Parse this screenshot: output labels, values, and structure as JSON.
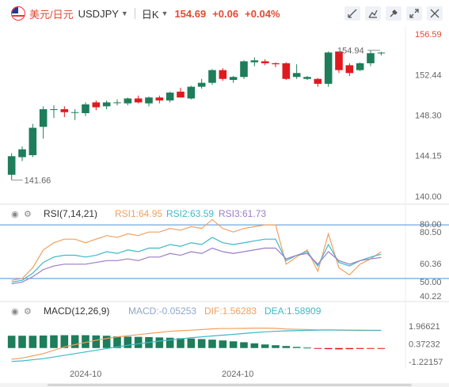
{
  "header": {
    "pair_cn": "美元/日元",
    "symbol": "USDJPY",
    "period": "日K",
    "price": "154.69",
    "change": "+0.06",
    "change_pct": "+0.04%"
  },
  "toolbar_icons": [
    "drawing-icon",
    "indicator-icon",
    "settings-icon",
    "fullscreen-icon",
    "maximize-icon"
  ],
  "colors": {
    "up": "#1e7d5a",
    "down": "#e0191f",
    "accent_red": "#e24a33",
    "rsi1": "#f0a060",
    "rsi2": "#3fb8c8",
    "rsi3": "#9b7cc8",
    "macd": "#8fa7c8",
    "dif": "#f0a060",
    "dea": "#3fb8c8"
  },
  "chart_data": [
    {
      "type": "candlestick",
      "axis_labels": [
        "156.59",
        "152.44",
        "148.30",
        "144.15",
        "140.00"
      ],
      "ylim": [
        140.0,
        156.59
      ],
      "high_label": "154.94",
      "low_label": "141.66",
      "candles": [
        {
          "o": 142.2,
          "h": 144.4,
          "l": 141.66,
          "c": 144.1
        },
        {
          "o": 144.0,
          "h": 145.1,
          "l": 143.6,
          "c": 144.8
        },
        {
          "o": 144.2,
          "h": 147.4,
          "l": 144.0,
          "c": 147.0
        },
        {
          "o": 147.1,
          "h": 149.2,
          "l": 145.9,
          "c": 148.9
        },
        {
          "o": 148.9,
          "h": 149.3,
          "l": 148.0,
          "c": 148.9
        },
        {
          "o": 148.9,
          "h": 149.2,
          "l": 148.1,
          "c": 148.6
        },
        {
          "o": 148.6,
          "h": 148.9,
          "l": 147.8,
          "c": 148.6
        },
        {
          "o": 148.5,
          "h": 149.6,
          "l": 148.2,
          "c": 149.4
        },
        {
          "o": 149.6,
          "h": 149.8,
          "l": 148.8,
          "c": 149.1
        },
        {
          "o": 149.2,
          "h": 149.8,
          "l": 148.9,
          "c": 149.6
        },
        {
          "o": 149.6,
          "h": 149.9,
          "l": 149.3,
          "c": 149.6
        },
        {
          "o": 149.5,
          "h": 150.1,
          "l": 149.3,
          "c": 150.0
        },
        {
          "o": 150.0,
          "h": 150.3,
          "l": 149.5,
          "c": 149.6
        },
        {
          "o": 149.5,
          "h": 150.2,
          "l": 149.2,
          "c": 150.1
        },
        {
          "o": 150.1,
          "h": 150.3,
          "l": 149.5,
          "c": 149.8
        },
        {
          "o": 149.8,
          "h": 150.7,
          "l": 149.6,
          "c": 150.6
        },
        {
          "o": 150.7,
          "h": 151.1,
          "l": 150.1,
          "c": 150.1
        },
        {
          "o": 150.0,
          "h": 151.3,
          "l": 149.9,
          "c": 151.2
        },
        {
          "o": 151.2,
          "h": 152.0,
          "l": 151.0,
          "c": 151.6
        },
        {
          "o": 151.6,
          "h": 153.0,
          "l": 151.4,
          "c": 152.9
        },
        {
          "o": 152.9,
          "h": 153.1,
          "l": 151.8,
          "c": 152.0
        },
        {
          "o": 151.9,
          "h": 152.3,
          "l": 151.6,
          "c": 152.2
        },
        {
          "o": 152.2,
          "h": 153.9,
          "l": 152.0,
          "c": 153.8
        },
        {
          "o": 153.7,
          "h": 154.2,
          "l": 153.3,
          "c": 153.9
        },
        {
          "o": 153.8,
          "h": 154.0,
          "l": 153.4,
          "c": 153.6
        },
        {
          "o": 153.6,
          "h": 153.7,
          "l": 153.2,
          "c": 153.5
        },
        {
          "o": 153.6,
          "h": 153.7,
          "l": 151.9,
          "c": 152.0
        },
        {
          "o": 152.2,
          "h": 153.5,
          "l": 152.0,
          "c": 152.6
        },
        {
          "o": 152.0,
          "h": 152.3,
          "l": 151.9,
          "c": 152.2
        },
        {
          "o": 152.0,
          "h": 152.1,
          "l": 151.2,
          "c": 151.5
        },
        {
          "o": 151.5,
          "h": 154.8,
          "l": 151.2,
          "c": 154.7
        },
        {
          "o": 154.8,
          "h": 154.8,
          "l": 152.6,
          "c": 152.9
        },
        {
          "o": 153.4,
          "h": 153.6,
          "l": 152.3,
          "c": 152.6
        },
        {
          "o": 152.9,
          "h": 153.7,
          "l": 152.8,
          "c": 153.6
        },
        {
          "o": 153.6,
          "h": 154.94,
          "l": 153.3,
          "c": 154.63
        },
        {
          "o": 154.63,
          "h": 154.78,
          "l": 154.4,
          "c": 154.69
        }
      ]
    },
    {
      "type": "line",
      "name": "RSI(7,14,21)",
      "series_labels": [
        "RSI1:64.95",
        "RSI2:63.59",
        "RSI3:61.73"
      ],
      "axis_labels": [
        "80.00",
        "80.50",
        "60.36",
        "50.00",
        "40.22"
      ],
      "ylim": [
        40.22,
        80.5
      ],
      "ref_lines": [
        80.0,
        50.0
      ],
      "series": [
        {
          "key": "rsi1",
          "values": [
            49,
            50,
            56,
            66,
            70,
            72,
            72,
            70,
            72,
            74,
            73,
            75,
            74,
            76,
            76,
            78,
            77,
            79,
            78,
            83,
            78,
            76,
            78,
            79,
            80,
            80,
            58,
            62,
            66,
            54,
            75,
            56,
            52,
            58,
            61,
            64.95
          ]
        },
        {
          "key": "rsi2",
          "values": [
            48,
            49,
            53,
            59,
            62,
            63,
            63,
            62,
            63,
            65,
            64,
            66,
            65,
            67,
            67,
            69,
            68,
            70,
            69,
            73,
            70,
            69,
            70,
            71,
            72,
            72,
            60,
            63,
            65,
            57,
            69,
            59,
            57,
            60,
            62,
            63.59
          ]
        },
        {
          "key": "rsi3",
          "values": [
            47,
            48,
            51,
            55,
            57,
            58,
            58,
            58,
            59,
            60,
            60,
            61,
            60,
            62,
            62,
            64,
            63,
            65,
            64,
            67,
            65,
            64,
            65,
            66,
            67,
            67,
            61,
            63,
            64,
            58,
            65,
            60,
            58,
            60,
            61,
            61.73
          ]
        }
      ]
    },
    {
      "type": "bar+line",
      "name": "MACD(12,26,9)",
      "series_labels": [
        "MACD:-0.05253",
        "DIF:1.56283",
        "DEA:1.58909"
      ],
      "axis_labels": [
        "1.96621",
        "0.37232",
        "-1.22157"
      ],
      "ylim": [
        -1.22157,
        1.96621
      ],
      "macd_hist": [
        1.1,
        1.1,
        1.1,
        1.12,
        1.14,
        1.15,
        1.15,
        1.15,
        1.13,
        1.1,
        1.05,
        1.02,
        1.0,
        0.98,
        0.95,
        0.92,
        0.88,
        0.85,
        0.8,
        0.75,
        0.68,
        0.6,
        0.52,
        0.42,
        0.32,
        0.25,
        0.18,
        0.1,
        0.04,
        -0.05,
        -0.1,
        -0.12,
        -0.1,
        -0.08,
        -0.06,
        -0.05253
      ],
      "dif": [
        -1.0,
        -0.9,
        -0.7,
        -0.5,
        -0.2,
        0.1,
        0.3,
        0.5,
        0.7,
        0.85,
        1.0,
        1.1,
        1.2,
        1.3,
        1.4,
        1.5,
        1.55,
        1.6,
        1.65,
        1.72,
        1.75,
        1.75,
        1.76,
        1.78,
        1.78,
        1.76,
        1.7,
        1.68,
        1.66,
        1.62,
        1.62,
        1.6,
        1.58,
        1.57,
        1.57,
        1.56283
      ],
      "dea": [
        -1.2,
        -1.15,
        -1.05,
        -0.95,
        -0.8,
        -0.65,
        -0.5,
        -0.35,
        -0.2,
        -0.05,
        0.1,
        0.25,
        0.38,
        0.5,
        0.62,
        0.72,
        0.82,
        0.92,
        1.0,
        1.08,
        1.15,
        1.22,
        1.3,
        1.38,
        1.45,
        1.5,
        1.53,
        1.56,
        1.58,
        1.6,
        1.61,
        1.61,
        1.6,
        1.6,
        1.59,
        1.58909
      ]
    }
  ],
  "x_labels": [
    "2024-10",
    "2024-10"
  ]
}
